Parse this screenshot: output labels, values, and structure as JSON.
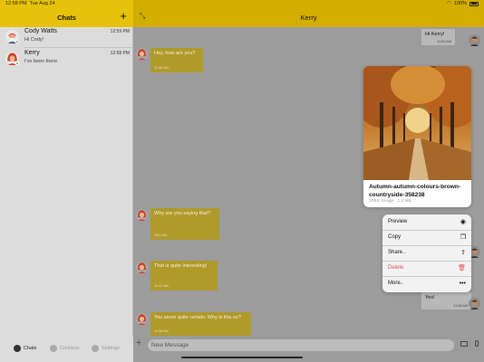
{
  "status": {
    "time": "12:58 PM",
    "date": "Tue Aug 24",
    "battery": "100%"
  },
  "sidebar": {
    "title": "Chats",
    "chats": [
      {
        "name": "Cody Watts",
        "message": "Hi Cody!",
        "time": "12:59 PM",
        "status_color": "#8a8a8a"
      },
      {
        "name": "Kerry",
        "message": "I've been there",
        "time": "12:58 PM",
        "status_color": "#35c33e"
      }
    ],
    "tabs": [
      {
        "label": "Chats",
        "active": true
      },
      {
        "label": "Contacts",
        "active": false
      },
      {
        "label": "Settings",
        "active": false
      }
    ]
  },
  "chat": {
    "title": "Kerry",
    "messages": [
      {
        "direction": "out",
        "text": "Hi Kerry!",
        "time": "11:50 AM"
      },
      {
        "direction": "in",
        "text": "Hey, how are you?",
        "time": "11:30 AM"
      },
      {
        "direction": "in",
        "text": "Why are you saying that?",
        "time": "10:0 AM"
      },
      {
        "direction": "in",
        "text": "That is quite interesting!",
        "time": "11:12 AM"
      },
      {
        "direction": "out",
        "text": "Yes!",
        "time": "11:36 AM"
      },
      {
        "direction": "in",
        "text": "You seem quite certain. Why is this so?",
        "time": "11:38 AM"
      }
    ],
    "attachment": {
      "filename": "Autumn-autumn-colours-brown-countryside-358238",
      "meta": "JPEG Image · 1.2 MB"
    },
    "context_menu": [
      {
        "label": "Preview",
        "icon": "eye-icon"
      },
      {
        "label": "Copy",
        "icon": "copy-icon"
      },
      {
        "label": "Share..",
        "icon": "share-icon"
      },
      {
        "label": "Delete",
        "icon": "trash-icon",
        "danger": true
      },
      {
        "label": "More..",
        "icon": "ellipsis-icon"
      }
    ],
    "composer": {
      "placeholder": "New Message"
    }
  },
  "colors": {
    "header_bar": "#d2ae00",
    "sidebar_header": "#e6c20a",
    "incoming_bubble": "#b09a2a",
    "danger": "#e05050"
  }
}
